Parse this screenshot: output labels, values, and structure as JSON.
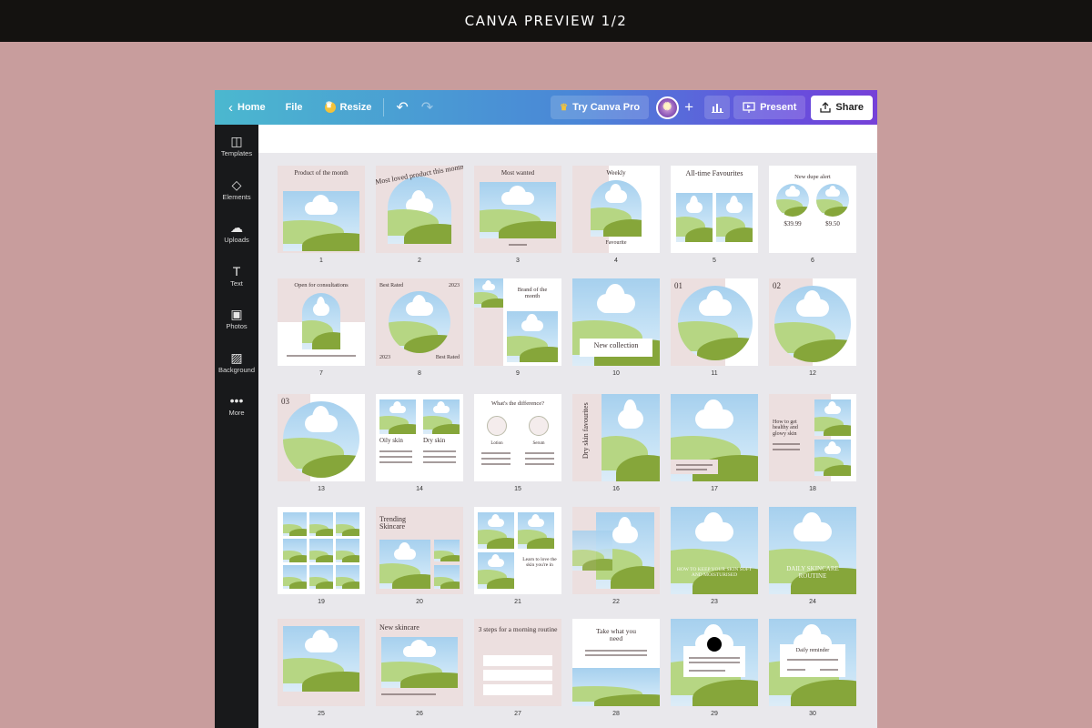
{
  "banner": {
    "title": "CANVA PREVIEW 1/2"
  },
  "toolbar": {
    "home_label": "Home",
    "file_label": "File",
    "resize_label": "Resize",
    "pro_label": "Try Canva Pro",
    "present_label": "Present",
    "share_label": "Share"
  },
  "sidebar": {
    "items": [
      {
        "label": "Templates",
        "icon": "templates-icon"
      },
      {
        "label": "Elements",
        "icon": "elements-icon"
      },
      {
        "label": "Uploads",
        "icon": "uploads-icon"
      },
      {
        "label": "Text",
        "icon": "text-icon"
      },
      {
        "label": "Photos",
        "icon": "photos-icon"
      },
      {
        "label": "Background",
        "icon": "background-icon"
      },
      {
        "label": "More",
        "icon": "more-icon"
      }
    ]
  },
  "pages": [
    {
      "number": "1",
      "title": "Product of the month"
    },
    {
      "number": "2",
      "title": "Most loved product this month"
    },
    {
      "number": "3",
      "title": "Most wanted"
    },
    {
      "number": "4",
      "title": "Weekly",
      "subtitle": "Favourite"
    },
    {
      "number": "5",
      "title": "All-time Favourites"
    },
    {
      "number": "6",
      "title": "New dupe alert",
      "price_a": "$39.99",
      "price_b": "$9.50"
    },
    {
      "number": "7",
      "title": "Open for consultations"
    },
    {
      "number": "8",
      "title": "Best Rated",
      "year": "2023"
    },
    {
      "number": "9",
      "title": "Brand of the month"
    },
    {
      "number": "10",
      "title": "New collection"
    },
    {
      "number": "11",
      "title": "01"
    },
    {
      "number": "12",
      "title": "02"
    },
    {
      "number": "13",
      "title": "03"
    },
    {
      "number": "14",
      "title": "Oily skin",
      "subtitle": "Dry skin"
    },
    {
      "number": "15",
      "title": "What's the difference?",
      "label_a": "Lotion",
      "label_b": "Serum"
    },
    {
      "number": "16",
      "title": "Dry skin favourites"
    },
    {
      "number": "17",
      "title": ""
    },
    {
      "number": "18",
      "title": "How to get healthy and glowy skin"
    },
    {
      "number": "19",
      "title": ""
    },
    {
      "number": "20",
      "title": "Trending Skincare"
    },
    {
      "number": "21",
      "title": "Learn to love the skin you're in"
    },
    {
      "number": "22",
      "title": ""
    },
    {
      "number": "23",
      "title": "HOW TO KEEP YOUR SKIN SOFT AND MOISTURISED"
    },
    {
      "number": "24",
      "title": "DAILY SKINCARE ROUTINE"
    },
    {
      "number": "25",
      "title": ""
    },
    {
      "number": "26",
      "title": "New skincare"
    },
    {
      "number": "27",
      "title": "3 steps for a morning routine"
    },
    {
      "number": "28",
      "title": "Take what you need"
    },
    {
      "number": "29",
      "title": ""
    },
    {
      "number": "30",
      "title": "Daily reminder"
    }
  ]
}
